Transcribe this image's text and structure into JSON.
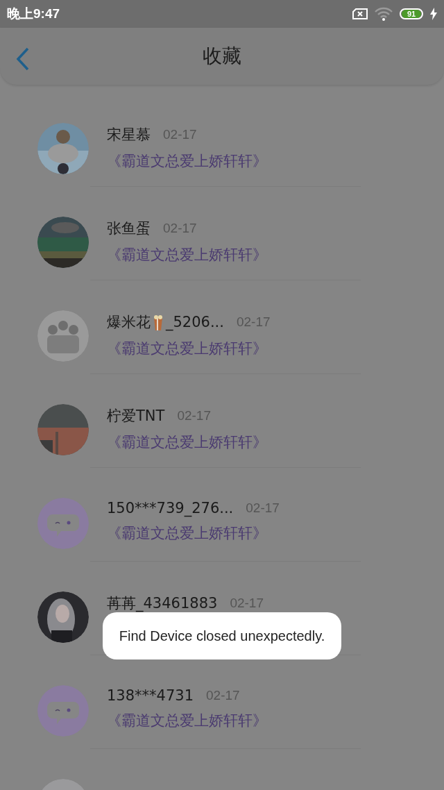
{
  "status_bar": {
    "time": "晚上9:47",
    "battery": "91"
  },
  "header": {
    "title": "收藏"
  },
  "items": [
    {
      "avatar": {
        "kind": "picture"
      },
      "name": "宋星慕",
      "date": "02-17",
      "subtitle": "《霸道文总爱上娇轩轩》"
    },
    {
      "avatar": {
        "kind": "picture"
      },
      "name": "张鱼蛋",
      "date": "02-17",
      "subtitle": "《霸道文总爱上娇轩轩》"
    },
    {
      "avatar": {
        "kind": "picture"
      },
      "name": "爆米花",
      "emoji_icon": true,
      "name_suffix": "_5206...",
      "date": "02-17",
      "subtitle": "《霸道文总爱上娇轩轩》"
    },
    {
      "avatar": {
        "kind": "picture"
      },
      "name": "柠爱TNT",
      "date": "02-17",
      "subtitle": "《霸道文总爱上娇轩轩》"
    },
    {
      "avatar": {
        "kind": "default"
      },
      "name": "150***739_276...",
      "date": "02-17",
      "subtitle": "《霸道文总爱上娇轩轩》"
    },
    {
      "avatar": {
        "kind": "picture"
      },
      "name": "苒苒_43461883",
      "date": "02-17"
    },
    {
      "avatar": {
        "kind": "default"
      },
      "name": "138***4731",
      "date": "02-17",
      "subtitle": "《霸道文总爱上娇轩轩》"
    },
    {
      "avatar": {
        "kind": "picture"
      }
    }
  ],
  "toast": {
    "message": "Find Device closed unexpectedly."
  }
}
